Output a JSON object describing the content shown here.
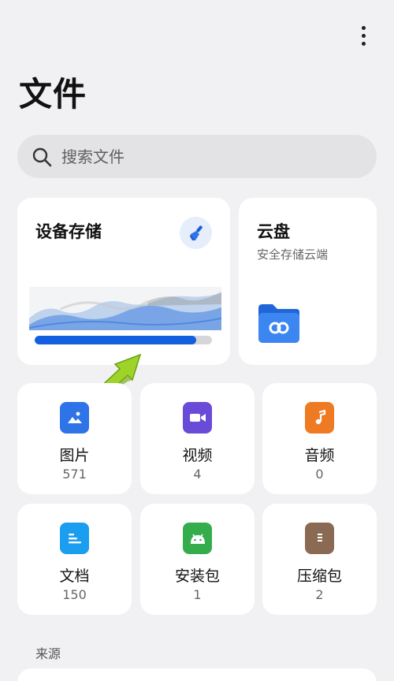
{
  "page": {
    "title": "文件"
  },
  "search": {
    "placeholder": "搜索文件"
  },
  "storage": {
    "title": "设备存储",
    "used_fraction": 0.91
  },
  "cloud": {
    "title": "云盘",
    "subtitle": "安全存储云端"
  },
  "categories": [
    {
      "name": "图片",
      "count": "571",
      "icon": "image-icon",
      "color": "#2f73e8"
    },
    {
      "name": "视频",
      "count": "4",
      "icon": "video-icon",
      "color": "#6a4bd8"
    },
    {
      "name": "音频",
      "count": "0",
      "icon": "music-icon",
      "color": "#ee7a23"
    },
    {
      "name": "文档",
      "count": "150",
      "icon": "document-icon",
      "color": "#1b9ef0"
    },
    {
      "name": "安装包",
      "count": "1",
      "icon": "android-icon",
      "color": "#35ad4c"
    },
    {
      "name": "压缩包",
      "count": "2",
      "icon": "archive-icon",
      "color": "#8a6a52"
    }
  ],
  "sources": {
    "label": "来源"
  },
  "colors": {
    "accent": "#1260e0",
    "background": "#f1f1f3",
    "card": "#ffffff",
    "search_bg": "#e3e3e6"
  }
}
